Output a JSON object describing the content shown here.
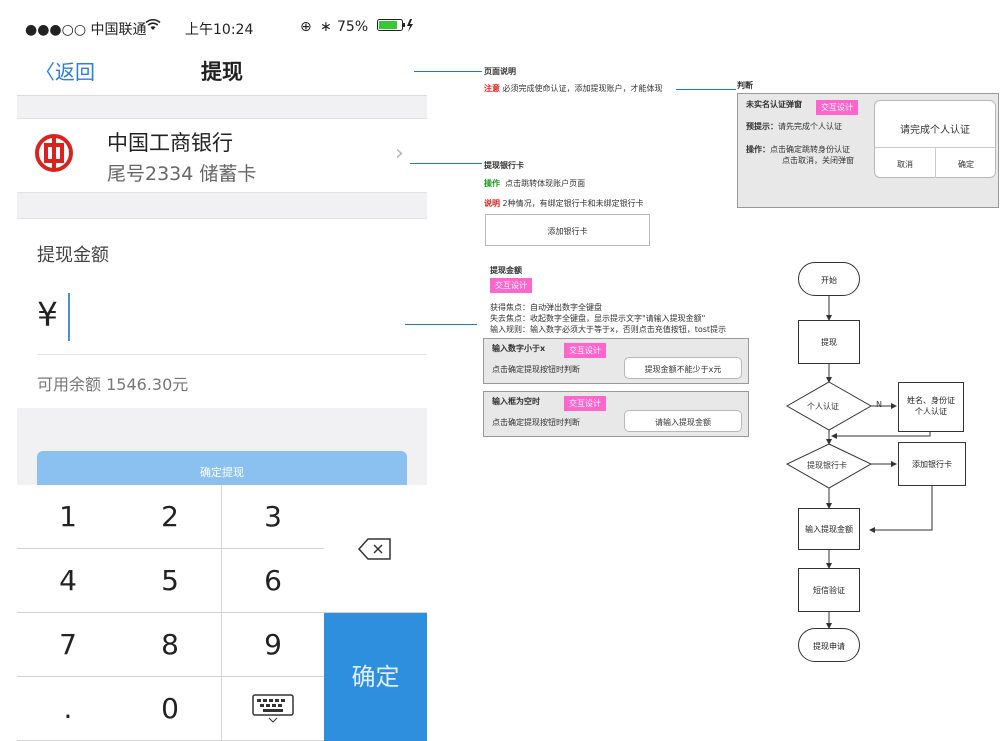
{
  "phone": {
    "status": {
      "carrier": "●●●○○ 中国联通",
      "wifi_icon": "wifi-icon",
      "time": "上午10:24",
      "battery": "75%"
    },
    "nav": {
      "back": "返回",
      "title": "提现"
    },
    "bank": {
      "name": "中国工商银行",
      "card": "尾号2334 储蓄卡"
    },
    "amount": {
      "label": "提现金额",
      "currency": "¥",
      "balance": "可用余额 1546.30元"
    },
    "confirm_button": "确定提现",
    "keypad": {
      "keys": [
        "1",
        "2",
        "3",
        "4",
        "5",
        "6",
        "7",
        "8",
        "9",
        ".",
        "0"
      ],
      "confirm": "确定"
    }
  },
  "annotations": {
    "page_desc": {
      "title": "页面说明",
      "note_label": "注意",
      "note": "必须完成使命认证，添加提现账户，才能体现"
    },
    "judge": {
      "title": "判断",
      "heading": "未实名认证弹窗",
      "tag": "交互设计",
      "prompt_label": "预提示：",
      "prompt": "请先完成个人认证",
      "op_label": "操作：",
      "op_line1": "点击确定跳转身份认证",
      "op_line2": "点击取消，关闭弹窗",
      "dialog_text": "请完成个人认证",
      "dialog_cancel": "取消",
      "dialog_ok": "确定"
    },
    "bank_card": {
      "title": "提现银行卡",
      "op_label": "操作",
      "op": "点击跳转体现账户页面",
      "desc_label": "说明",
      "desc": "2种情况，有绑定银行卡和未绑定银行卡",
      "add_button": "添加银行卡"
    },
    "amount": {
      "title": "提现金额",
      "tag": "交互设计",
      "line1": "获得焦点：自动弹出数字全键盘",
      "line2": "失去焦点：收起数字全键盘，显示提示文字\"请输入提现金额\"",
      "line3": "输入规则：输入数字必须大于等于x，否则点击充值按钮，tost提示",
      "case1": {
        "title": "输入数字小于x",
        "tag": "交互设计",
        "text": "点击确定提现按钮时判断",
        "toast": "提现金额不能少于x元"
      },
      "case2": {
        "title": "输入框为空时",
        "tag": "交互设计",
        "text": "点击确定提现按钮时判断",
        "toast": "请输入提现金额"
      }
    }
  },
  "flowchart": {
    "start": "开始",
    "withdraw": "提现",
    "auth": "个人认证",
    "no_label": "N",
    "verify_line1": "姓名、身份证",
    "verify_line2": "个人认证",
    "card": "提现银行卡",
    "add_card": "添加银行卡",
    "input": "输入提现金额",
    "sms": "短信验证",
    "apply": "提现申请"
  },
  "colors": {
    "accent": "#2e8fde",
    "button_light": "#8ac1f0",
    "tag": "#ff66cc",
    "note_red": "#e02020",
    "op_green": "#1a9a1a"
  }
}
